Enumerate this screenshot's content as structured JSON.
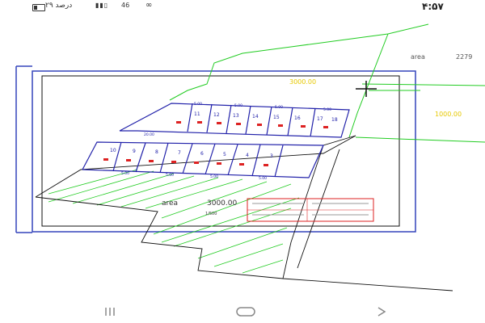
{
  "status_bar": {
    "time": "۴:۵۷",
    "battery_text": "۲۹ درصد",
    "signal_text": "46",
    "wifi_text": "4G"
  },
  "drawing": {
    "area_label_center": "area",
    "area_value_center": "3000.00",
    "area_label_right": "area",
    "area_value_right": "2279",
    "yellow_label_top": "3000.00",
    "yellow_label_right": "1000.00",
    "scale_text": "1/500",
    "row_top_numbers": [
      "11",
      "12",
      "13",
      "14",
      "15",
      "16",
      "17",
      "18"
    ],
    "row_bottom_numbers": [
      "10",
      "9",
      "8",
      "7",
      "6",
      "5",
      "4",
      "3"
    ],
    "dimension_text": "5.00",
    "small_dimension_text": "20.00",
    "colors": {
      "green": "#22cc22",
      "blue": "#2222aa",
      "red": "#dd2222",
      "yellow": "#e6c800",
      "frame": "#3344bb"
    }
  },
  "nav": {
    "recents_icon": "recents-icon",
    "home_icon": "home-icon",
    "back_icon": "back-icon"
  }
}
